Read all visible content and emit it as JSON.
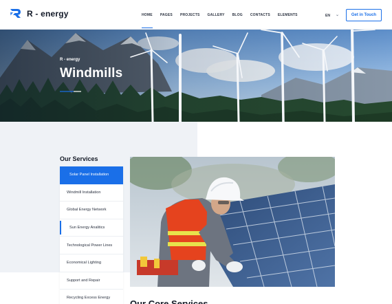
{
  "brand": {
    "name": "R - energy",
    "accent": "#1a6fe8"
  },
  "nav": {
    "items": [
      {
        "label": "HOME",
        "active": true
      },
      {
        "label": "PAGES"
      },
      {
        "label": "PROJECTS"
      },
      {
        "label": "GALLERY"
      },
      {
        "label": "BLOG"
      },
      {
        "label": "CONTACTS"
      },
      {
        "label": "ELEMENTS"
      }
    ],
    "language": "EN",
    "cta_label": "Get in Touch"
  },
  "hero": {
    "breadcrumb": "R - energy",
    "title": "Windmills"
  },
  "services": {
    "heading": "Our Services",
    "items": [
      {
        "label": "Solar Panel Installation",
        "active": true
      },
      {
        "label": "Windmill Installation"
      },
      {
        "label": "Global Energy Network"
      },
      {
        "label": "Sun Energy Analitics",
        "marked": true
      },
      {
        "label": "Technological Power Lines"
      },
      {
        "label": "Economical Lighting"
      },
      {
        "label": "Support and Repair"
      },
      {
        "label": "Recycling Excess Energy"
      }
    ]
  },
  "content": {
    "heading_partial": "Our Core Services"
  }
}
